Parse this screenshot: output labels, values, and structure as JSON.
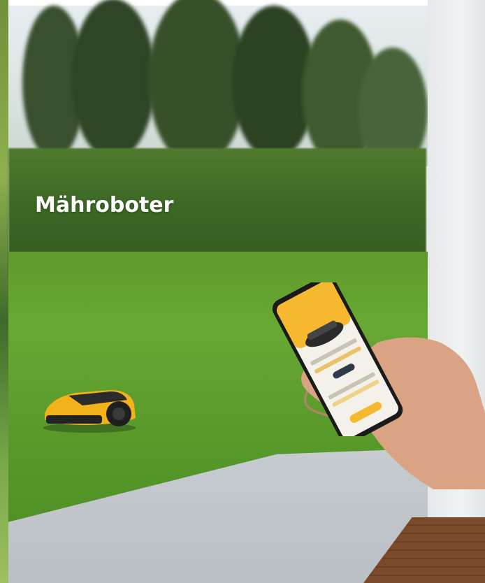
{
  "page": {
    "title": "Mähroboter"
  },
  "icons": {
    "mower": "robot-mower-icon",
    "phone": "smartphone-icon"
  },
  "colors": {
    "title": "#ffffff",
    "mower_body": "#f2b21c",
    "app_accent": "#f5b82e"
  }
}
